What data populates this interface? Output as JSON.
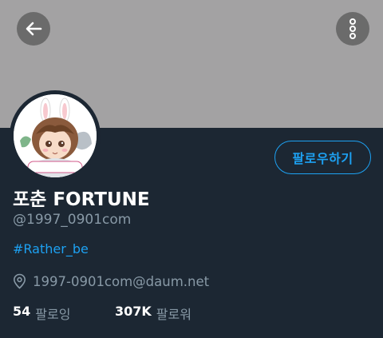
{
  "header": {
    "back_icon": "arrow-left-icon",
    "more_icon": "more-vertical-icon",
    "banner_color": "#a3a2a3"
  },
  "profile": {
    "avatar_text": "FORTUNE",
    "follow_label": "팔로우하기",
    "name": "포춘 FORTUNE",
    "handle": "@1997_0901com",
    "bio": "#Rather_be",
    "location_icon": "location-pin-icon",
    "location": "1997-0901com@daum.net",
    "following_count": "54",
    "following_label": "팔로잉",
    "followers_count": "307K",
    "followers_label": "팔로워"
  },
  "colors": {
    "background": "#1c2733",
    "accent": "#1da1f2",
    "muted_text": "#8899a6"
  }
}
